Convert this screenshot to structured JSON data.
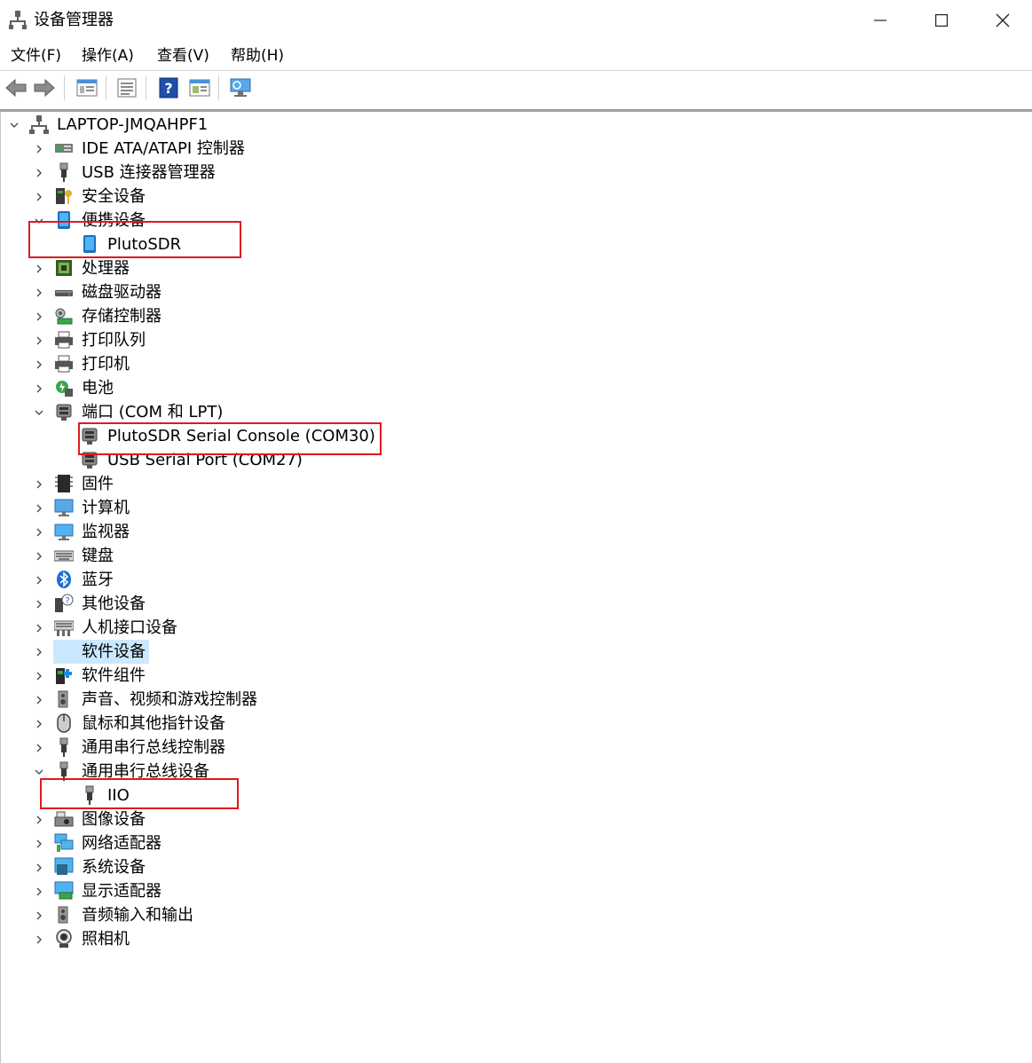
{
  "window": {
    "title": "设备管理器",
    "controls": [
      "minimize",
      "maximize",
      "close"
    ]
  },
  "menu": [
    "文件(F)",
    "操作(A)",
    "查看(V)",
    "帮助(H)"
  ],
  "toolbar": [
    "back-icon",
    "forward-icon",
    "properties-icon",
    "list-icon",
    "help-icon",
    "action-icon",
    "monitor-icon"
  ],
  "tree": {
    "root": {
      "label": "LAPTOP-JMQAHPF1",
      "expanded": true
    },
    "items": [
      {
        "label": "IDE ATA/ATAPI 控制器",
        "icon": "ide-controller-icon",
        "expanded": false
      },
      {
        "label": "USB 连接器管理器",
        "icon": "usb-plug-icon",
        "expanded": false
      },
      {
        "label": "安全设备",
        "icon": "security-key-icon",
        "expanded": false
      },
      {
        "label": "便携设备",
        "icon": "portable-device-icon",
        "expanded": true
      },
      {
        "label": "PlutoSDR",
        "icon": "portable-device-icon",
        "child": true
      },
      {
        "label": "处理器",
        "icon": "cpu-icon",
        "expanded": false
      },
      {
        "label": "磁盘驱动器",
        "icon": "disk-drive-icon",
        "expanded": false
      },
      {
        "label": "存储控制器",
        "icon": "storage-controller-icon",
        "expanded": false
      },
      {
        "label": "打印队列",
        "icon": "printer-icon",
        "expanded": false
      },
      {
        "label": "打印机",
        "icon": "printer-icon",
        "expanded": false
      },
      {
        "label": "电池",
        "icon": "battery-icon",
        "expanded": false
      },
      {
        "label": "端口 (COM 和 LPT)",
        "icon": "port-icon",
        "expanded": true
      },
      {
        "label": "PlutoSDR Serial Console (COM30)",
        "icon": "port-icon",
        "child": true
      },
      {
        "label": "USB Serial Port (COM27)",
        "icon": "port-icon",
        "child": true
      },
      {
        "label": "固件",
        "icon": "firmware-icon",
        "expanded": false
      },
      {
        "label": "计算机",
        "icon": "computer-icon",
        "expanded": false
      },
      {
        "label": "监视器",
        "icon": "monitor-icon",
        "expanded": false
      },
      {
        "label": "键盘",
        "icon": "keyboard-icon",
        "expanded": false
      },
      {
        "label": "蓝牙",
        "icon": "bluetooth-icon",
        "expanded": false
      },
      {
        "label": "其他设备",
        "icon": "unknown-device-icon",
        "expanded": false
      },
      {
        "label": "人机接口设备",
        "icon": "hid-icon",
        "expanded": false
      },
      {
        "label": "软件设备",
        "icon": "software-device-icon",
        "expanded": false,
        "selected": true
      },
      {
        "label": "软件组件",
        "icon": "software-component-icon",
        "expanded": false
      },
      {
        "label": "声音、视频和游戏控制器",
        "icon": "speaker-icon",
        "expanded": false
      },
      {
        "label": "鼠标和其他指针设备",
        "icon": "mouse-icon",
        "expanded": false
      },
      {
        "label": "通用串行总线控制器",
        "icon": "usb-plug-icon",
        "expanded": false
      },
      {
        "label": "通用串行总线设备",
        "icon": "usb-plug-icon",
        "expanded": true
      },
      {
        "label": "IIO",
        "icon": "usb-plug-icon",
        "child": true
      },
      {
        "label": "图像设备",
        "icon": "imaging-device-icon",
        "expanded": false
      },
      {
        "label": "网络适配器",
        "icon": "network-adapter-icon",
        "expanded": false
      },
      {
        "label": "系统设备",
        "icon": "system-device-icon",
        "expanded": false
      },
      {
        "label": "显示适配器",
        "icon": "display-adapter-icon",
        "expanded": false
      },
      {
        "label": "音频输入和输出",
        "icon": "speaker-icon",
        "expanded": false
      },
      {
        "label": "照相机",
        "icon": "camera-icon",
        "expanded": false
      }
    ]
  },
  "colors": {
    "highlight_box": "#e0191f",
    "selection": "#cce8ff",
    "accent": "#1e88e5"
  }
}
